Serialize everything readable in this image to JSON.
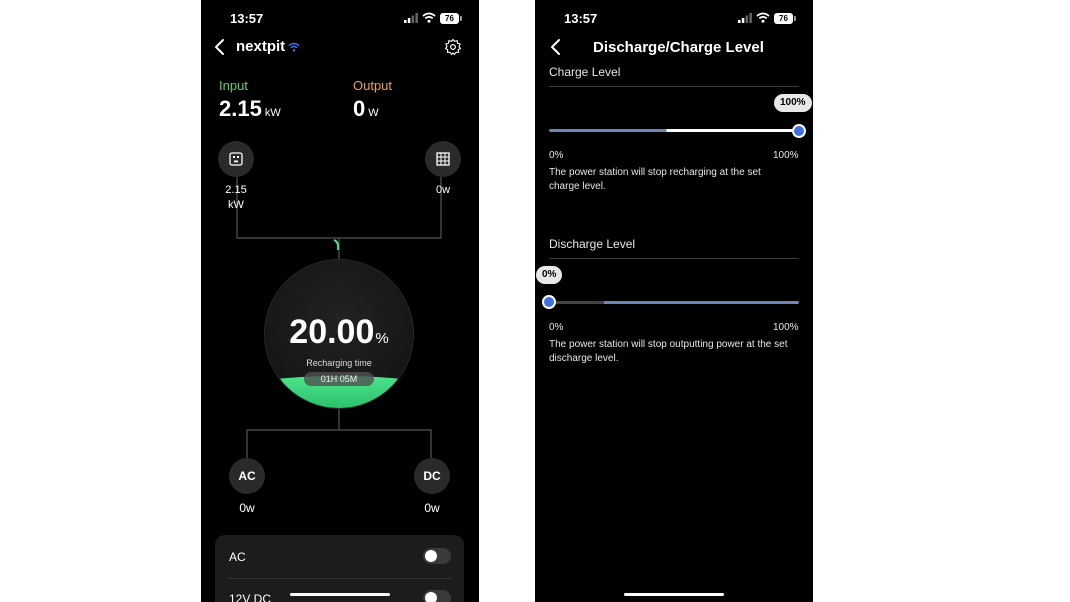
{
  "status_bar": {
    "time": "13:57",
    "battery": "76"
  },
  "left": {
    "device_name": "nextpit",
    "input": {
      "label": "Input",
      "value": "2.15",
      "unit": "kW",
      "color": "#5fd35f"
    },
    "output": {
      "label": "Output",
      "value": "0",
      "unit": "W",
      "color": "#f2a33a"
    },
    "input_source": {
      "value": "2.15",
      "unit": "kW"
    },
    "output_source": {
      "value": "0w"
    },
    "battery": {
      "percent": "20.00",
      "symbol": "%",
      "recharge_label": "Recharging time",
      "recharge_time": "01H 05M",
      "level": 0.2
    },
    "ac_port": {
      "label": "AC",
      "value": "0w"
    },
    "dc_port": {
      "label": "DC",
      "value": "0w"
    },
    "panel": {
      "row1": {
        "label": "AC",
        "on": false
      },
      "row2": {
        "label": "12V DC",
        "on": false
      }
    }
  },
  "right": {
    "title": "Discharge/Charge Level",
    "charge": {
      "title": "Charge Level",
      "value_label": "100%",
      "min": "0%",
      "max": "100%",
      "value": 1.0,
      "description": "The power station will stop recharging at the set charge level."
    },
    "discharge": {
      "title": "Discharge Level",
      "value_label": "0%",
      "min": "0%",
      "max": "100%",
      "value": 0.0,
      "description": "The power station will stop outputting power at the set discharge level."
    }
  },
  "colors": {
    "accent_blue": "#3f6fe0",
    "green": "#4de38c"
  }
}
